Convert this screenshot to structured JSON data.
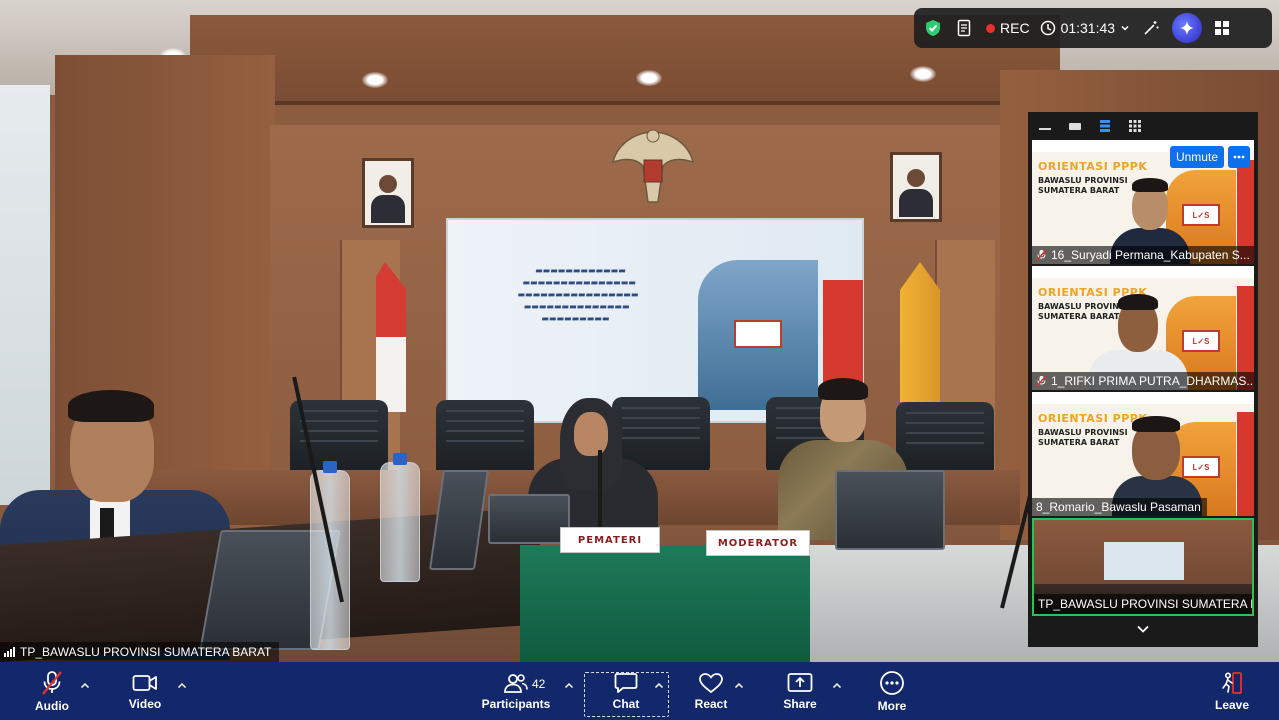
{
  "status_bar": {
    "rec_label": "REC",
    "elapsed": "01:31:43"
  },
  "main_video": {
    "speaker_name": "TP_BAWASLU PROVINSI SUMATERA BARAT",
    "placard_left": "PEMATERI",
    "placard_right": "MODERATOR"
  },
  "gallery": {
    "unmute_label": "Unmute",
    "tiles": [
      {
        "name": "16_Suryadi Permana_Kabupaten S...",
        "banner_title": "ORIENTASI PPPK",
        "banner_sub1": "BAWASLU PROVINSI",
        "banner_sub2": "SUMATERA BARAT",
        "muted": true
      },
      {
        "name": "1_RIFKI PRIMA PUTRA_DHARMAS...",
        "banner_title": "ORIENTASI PPPK",
        "banner_sub1": "BAWASLU PROVINSI",
        "banner_sub2": "SUMATERA BARAT",
        "muted": true
      },
      {
        "name": "8_Romario_Bawaslu Pasaman",
        "banner_title": "ORIENTASI PPPK",
        "banner_sub1": "BAWASLU PROVINSI",
        "banner_sub2": "SUMATERA BARAT",
        "muted": false
      },
      {
        "name": "TP_BAWASLU PROVINSI SUMATERA B...",
        "active_speaker": true
      }
    ]
  },
  "toolbar": {
    "audio": "Audio",
    "video": "Video",
    "participants": "Participants",
    "participant_count": "42",
    "chat": "Chat",
    "react": "React",
    "share": "Share",
    "more": "More",
    "leave": "Leave"
  },
  "colors": {
    "toolbar_bg": "#13276b",
    "accent_blue": "#0e71eb",
    "rec_red": "#e5322d",
    "active_speaker_border": "#2ebf56",
    "shield_green": "#2ecc71"
  }
}
